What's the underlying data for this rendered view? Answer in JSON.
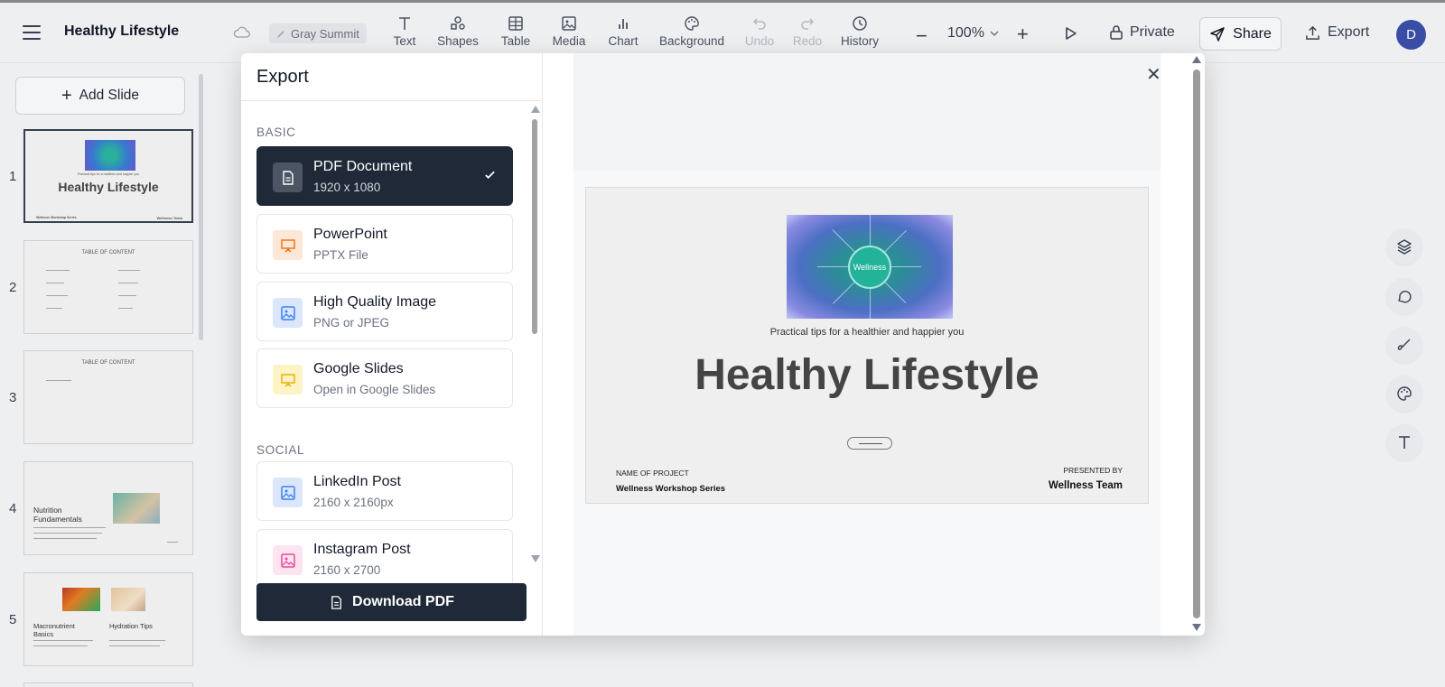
{
  "app": {
    "title": "Healthy Lifestyle",
    "theme": "Gray Summit",
    "avatar_initial": "D"
  },
  "toolbar": {
    "tools": [
      {
        "label": "Text",
        "icon": "text-icon",
        "enabled": true
      },
      {
        "label": "Shapes",
        "icon": "shapes-icon",
        "enabled": true
      },
      {
        "label": "Table",
        "icon": "table-icon",
        "enabled": true
      },
      {
        "label": "Media",
        "icon": "image-icon",
        "enabled": true
      },
      {
        "label": "Chart",
        "icon": "chart-icon",
        "enabled": true
      },
      {
        "label": "Background",
        "icon": "palette-icon",
        "enabled": true
      },
      {
        "label": "Undo",
        "icon": "undo-icon",
        "enabled": false
      },
      {
        "label": "Redo",
        "icon": "redo-icon",
        "enabled": false
      },
      {
        "label": "History",
        "icon": "clock-icon",
        "enabled": true
      }
    ],
    "zoom": "100%",
    "private_label": "Private",
    "share_label": "Share",
    "export_label": "Export"
  },
  "sidebar": {
    "add_slide_label": "Add Slide",
    "slides": [
      {
        "num": "1",
        "title": "Healthy Lifestyle",
        "tagline": "Practical tips for a healthier and happier you",
        "left": "Wellness Workshop Series",
        "right": "Wellness Team"
      },
      {
        "num": "2",
        "title": "TABLE OF CONTENT"
      },
      {
        "num": "3",
        "title": "TABLE OF CONTENT"
      },
      {
        "num": "4",
        "title": "Nutrition Fundamentals"
      },
      {
        "num": "5",
        "title": "Macronutrient Basics",
        "title2": "Hydration Tips"
      }
    ]
  },
  "modal": {
    "title": "Export",
    "sections": [
      {
        "label": "BASIC",
        "options": [
          {
            "title": "PDF Document",
            "sub": "1920 x 1080",
            "icon": "document-icon",
            "selected": true,
            "icon_bg": "#4b5563",
            "icon_color": "#ffffff"
          },
          {
            "title": "PowerPoint",
            "sub": "PPTX File",
            "icon": "presentation-icon",
            "selected": false,
            "icon_bg": "#fde7d6",
            "icon_color": "#f97316"
          },
          {
            "title": "High Quality Image",
            "sub": "PNG or JPEG",
            "icon": "image-icon",
            "selected": false,
            "icon_bg": "#dbe6fb",
            "icon_color": "#3b82f6"
          },
          {
            "title": "Google Slides",
            "sub": "Open in Google Slides",
            "icon": "presentation-icon",
            "selected": false,
            "icon_bg": "#fdf3c4",
            "icon_color": "#eab308"
          }
        ]
      },
      {
        "label": "SOCIAL",
        "options": [
          {
            "title": "LinkedIn Post",
            "sub": "2160 x 2160px",
            "icon": "image-icon",
            "selected": false,
            "icon_bg": "#dbe6fb",
            "icon_color": "#3b82f6"
          },
          {
            "title": "Instagram Post",
            "sub": "2160 x 2700",
            "icon": "image-icon",
            "selected": false,
            "icon_bg": "#fde4ef",
            "icon_color": "#ec4899"
          }
        ]
      }
    ],
    "download_label": "Download PDF",
    "preview": {
      "wheel_center": "Wellness",
      "tagline": "Practical tips for a healthier and happier you",
      "title": "Healthy Lifestyle",
      "project_label": "NAME OF PROJECT",
      "project_value": "Wellness Workshop Series",
      "presented_label": "PRESENTED BY",
      "presented_value": "Wellness Team"
    }
  },
  "colors": {
    "dark": "#1f2937",
    "accent_blue": "#3b4fa8"
  }
}
